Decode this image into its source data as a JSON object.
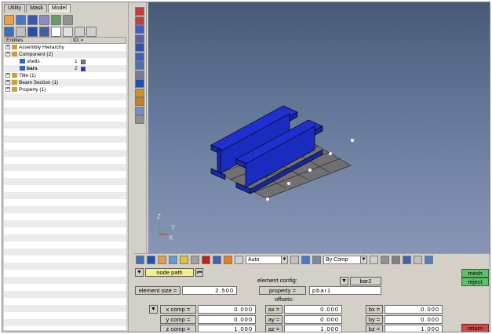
{
  "tabs": [
    "Utility",
    "Mask",
    "Model"
  ],
  "entities_header": {
    "entities": "Entities",
    "id": "ID"
  },
  "tree": [
    {
      "label": "Assembly Hierarchy",
      "id": "",
      "indent": 0,
      "bold": false,
      "color": ""
    },
    {
      "label": "Component (2)",
      "id": "",
      "indent": 0,
      "bold": false,
      "color": ""
    },
    {
      "label": "shells",
      "id": "1",
      "indent": 2,
      "bold": false,
      "color": "#808080"
    },
    {
      "label": "bars",
      "id": "2",
      "indent": 2,
      "bold": true,
      "color": "#1f2fd0"
    },
    {
      "label": "Title (1)",
      "id": "",
      "indent": 0,
      "bold": false,
      "color": ""
    },
    {
      "label": "Beam Section (1)",
      "id": "",
      "indent": 0,
      "bold": false,
      "color": ""
    },
    {
      "label": "Property (1)",
      "id": "",
      "indent": 0,
      "bold": false,
      "color": ""
    }
  ],
  "viewport": {
    "axis_labels": {
      "z": "Z",
      "y": "Y",
      "x": "X"
    },
    "bg_color": "#5a6d8f",
    "mesh_color": "#6e6e6e",
    "beam_color": "#1f2fd0"
  },
  "bottom_toolbar": {
    "auto_combo": "Auto",
    "bycomp_combo": "By Comp"
  },
  "form": {
    "node_path": "node path",
    "element_config_label": "element config:",
    "element_config_value": "bar2",
    "element_size_label": "element size =",
    "element_size_value": "2.500",
    "property_label": "property =",
    "property_value": "pbar1",
    "offsets_label": "offsets:",
    "x_comp_label": "x comp =",
    "x_comp_value": "0.000",
    "y_comp_label": "y comp =",
    "y_comp_value": "0.000",
    "z_comp_label": "z comp =",
    "z_comp_value": "1.000",
    "ax_label": "ax =",
    "ax_value": "0.000",
    "ay_label": "ay =",
    "ay_value": "0.000",
    "az_label": "az =",
    "az_value": "1.000",
    "bx_label": "bx =",
    "bx_value": "0.000",
    "by_label": "by =",
    "by_value": "0.000",
    "bz_label": "bz =",
    "bz_value": "1.000",
    "mesh_button": "mesh",
    "reject_button": "reject",
    "return_button": "return"
  }
}
